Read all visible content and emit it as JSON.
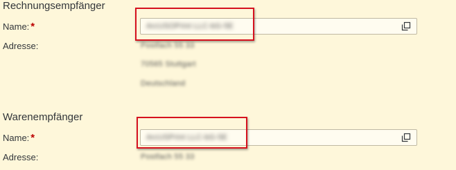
{
  "billing": {
    "section_title": "Rechnungsempfänger",
    "name_label": "Name:",
    "required_marker": "*",
    "name_value": "ArcUSOPrint LLC-bG-5E",
    "address_label": "Adresse:",
    "address_lines": [
      "Postfach 55 33",
      "70565 Stuttgart",
      "Deutschland"
    ]
  },
  "shipping": {
    "section_title": "Warenempfänger",
    "name_label": "Name:",
    "required_marker": "*",
    "name_value": "ArcUSPrint LLC-bG-5E",
    "address_label": "Adresse:",
    "address_lines": [
      "Postfach 55 33"
    ]
  },
  "icons": {
    "value_help": "value-help-icon"
  },
  "colors": {
    "background": "#FEF7DA",
    "required": "#bb0000",
    "highlight": "#d6111e"
  }
}
